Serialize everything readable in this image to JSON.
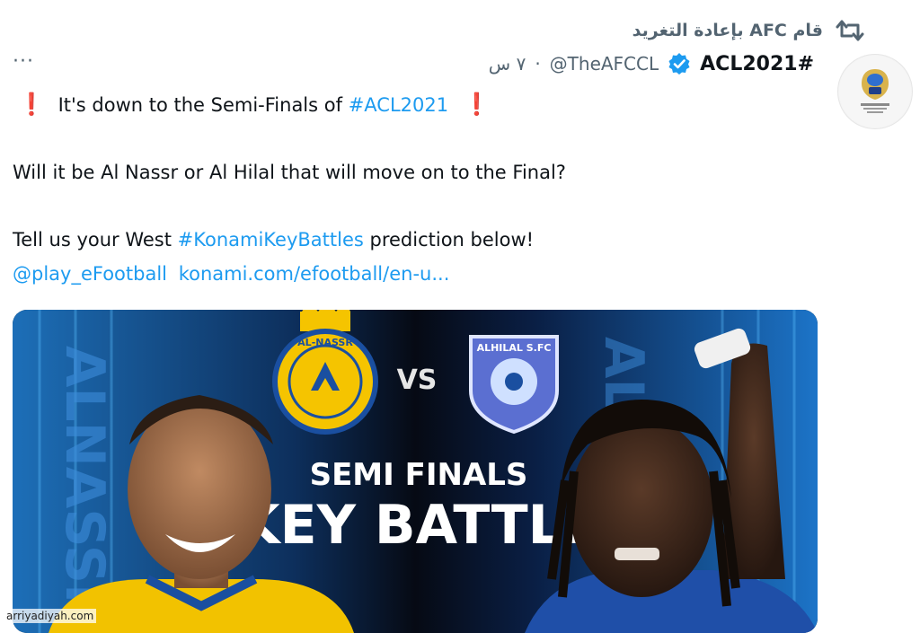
{
  "retweet": {
    "text": "قام AFC بإعادة التغريد",
    "icon": "retweet-icon"
  },
  "author": {
    "display_name": "#ACL2021",
    "handle": "@TheAFCCL",
    "separator": "·",
    "time": "٧ س",
    "verified_icon": "verified-badge-icon",
    "avatar": "afc-champions-league-logo"
  },
  "more_label": "···",
  "tweet": {
    "line1_pre": "It's down to the Semi-Finals of ",
    "line1_hashtag": "#ACL2021",
    "exclamation": "❗",
    "line2": "Will it be Al Nassr or Al Hilal that will move on to the Final?",
    "line3_pre": "Tell us your West ",
    "line3_hashtag": "#KonamiKeyBattles",
    "line3_post": " prediction below!",
    "mention": "@play_eFootball",
    "url": "konami.com/efootball/en-u..."
  },
  "media": {
    "vs_label": "VS",
    "title_small": "SEMI FINALS",
    "title_big": "KEY BATTLE",
    "left_crest": "AL-NASSR",
    "right_crest": "ALHILAL S.FC",
    "side_text_left": "ALNASSR",
    "side_text_right": "ALHILAL"
  },
  "watermark": "arriyadiyah.com",
  "colors": {
    "link": "#1d9bf0",
    "muted": "#536471",
    "alert_red": "#e0232c",
    "nassr_yellow": "#f5c400",
    "hilal_blue": "#1a4fa0"
  }
}
